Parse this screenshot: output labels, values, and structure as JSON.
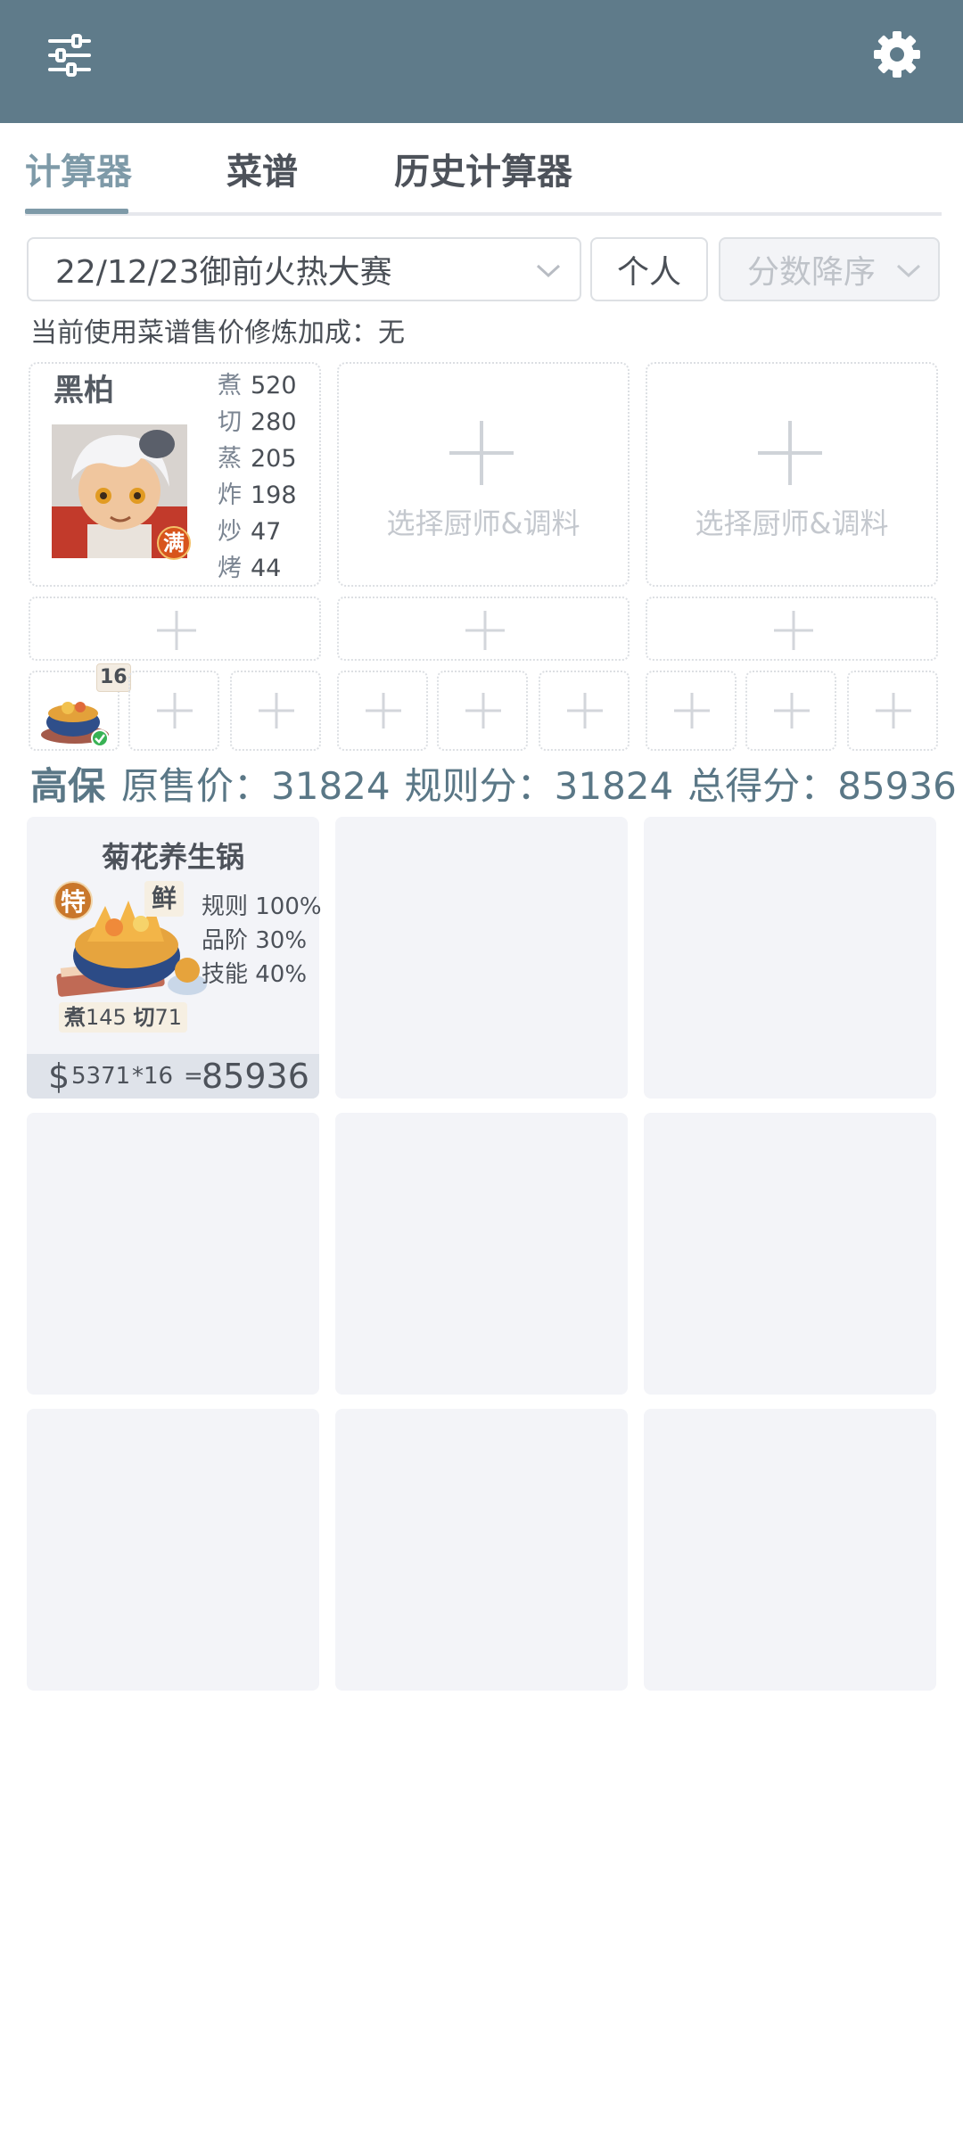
{
  "header": {
    "menu_icon": "sliders-icon",
    "settings_icon": "gear-icon"
  },
  "tabs": [
    {
      "label": "计算器",
      "active": true
    },
    {
      "label": "菜谱",
      "active": false
    },
    {
      "label": "历史计算器",
      "active": false
    }
  ],
  "controls": {
    "event_select": "22/12/23御前火热大赛",
    "mode_button": "个人",
    "sort_select": "分数降序"
  },
  "bonus_text": "当前使用菜谱售价修炼加成：无",
  "chef": {
    "name": "黑柏",
    "badge": "满",
    "stats": [
      {
        "k": "煮",
        "v": "520"
      },
      {
        "k": "切",
        "v": "280"
      },
      {
        "k": "蒸",
        "v": "205"
      },
      {
        "k": "炸",
        "v": "198"
      },
      {
        "k": "炒",
        "v": "47"
      },
      {
        "k": "烤",
        "v": "44"
      }
    ]
  },
  "empty_chef_label": "选择厨师&调料",
  "first_slot_count": "16",
  "summary": {
    "grade": "高保",
    "original_price": "原售价：31824",
    "rule_score": "规则分：31824",
    "total_score": "总得分：85936"
  },
  "recipe": {
    "name": "菊花养生锅",
    "tag_special": "特",
    "tag_fresh": "鲜",
    "pcts": [
      "规则 100%",
      "品阶 30%",
      "技能 40%"
    ],
    "req": [
      {
        "k": "煮",
        "v": "145"
      },
      {
        "k": "切",
        "v": "71"
      }
    ],
    "currency": "$",
    "price": "5371",
    "multiplier": "*16",
    "equals": "=",
    "total": "85936"
  },
  "colors": {
    "header": "#5f7b8a",
    "accent": "#7e9aa8",
    "card_bg": "#f3f4f8",
    "placeholder": "#c4c8ce"
  }
}
